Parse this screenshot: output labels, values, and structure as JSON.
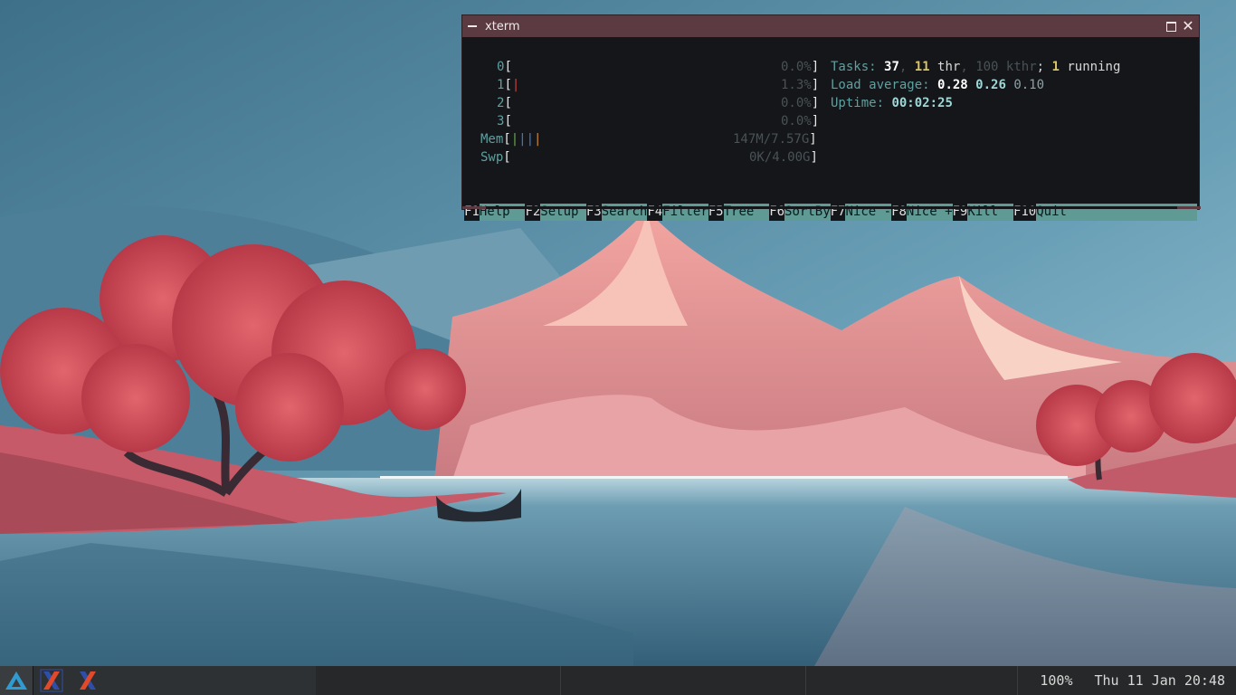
{
  "window": {
    "title": "xterm"
  },
  "htop": {
    "cpus": [
      {
        "label": "0",
        "percent": "0.0%"
      },
      {
        "label": "1",
        "percent": "1.3%"
      },
      {
        "label": "2",
        "percent": "0.0%"
      },
      {
        "label": "3",
        "percent": "0.0%"
      }
    ],
    "mem": {
      "label": "Mem",
      "value": "147M/7.57G"
    },
    "swp": {
      "label": "Swp",
      "value": "0K/4.00G"
    },
    "tasks": {
      "label": "Tasks:",
      "count": "37",
      "thr": "11",
      "thr_label": "thr",
      "kthr": "100",
      "kthr_label": "kthr",
      "running": "1",
      "running_label": "running"
    },
    "load": {
      "label": "Load average:",
      "v1": "0.28",
      "v5": "0.26",
      "v15": "0.10"
    },
    "uptime": {
      "label": "Uptime:",
      "value": "00:02:25"
    },
    "fkeys": [
      {
        "key": "F1",
        "label": "Help  "
      },
      {
        "key": "F2",
        "label": "Setup "
      },
      {
        "key": "F3",
        "label": "Search"
      },
      {
        "key": "F4",
        "label": "Filter"
      },
      {
        "key": "F5",
        "label": "Tree  "
      },
      {
        "key": "F6",
        "label": "SortBy"
      },
      {
        "key": "F7",
        "label": "Nice -"
      },
      {
        "key": "F8",
        "label": "Nice +"
      },
      {
        "key": "F9",
        "label": "Kill  "
      },
      {
        "key": "F10",
        "label": "Quit"
      }
    ]
  },
  "taskbar": {
    "start_icon": "arch-start-icon",
    "apps": [
      {
        "name": "xterm-1",
        "icon": "x-icon"
      },
      {
        "name": "xterm-2",
        "icon": "x-icon"
      }
    ],
    "zoom": "100%",
    "clock": "Thu 11 Jan 20:48"
  },
  "colors": {
    "titlebar": "#5b3a41",
    "terminal_bg": "#141619",
    "fkey_bg": "#5f9a94",
    "taskbar_bg": "#262829"
  }
}
